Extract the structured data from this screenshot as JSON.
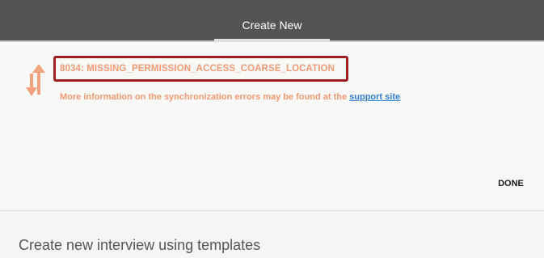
{
  "tab": {
    "label": "Create New"
  },
  "dialog": {
    "icon": "sync-arrows-icon",
    "error_code": "8034: MISSING_PERMISSION_ACCESS_COARSE_LOCATION",
    "info_text": "More information on the synchronization errors may be found at the ",
    "link_text": "support site",
    "done_label": "DONE"
  },
  "section": {
    "title": "Create new interview using templates"
  },
  "colors": {
    "top_bar": "#545454",
    "error_text": "#ef9a72",
    "highlight_border": "#a01f24",
    "link": "#2f7fd2"
  }
}
